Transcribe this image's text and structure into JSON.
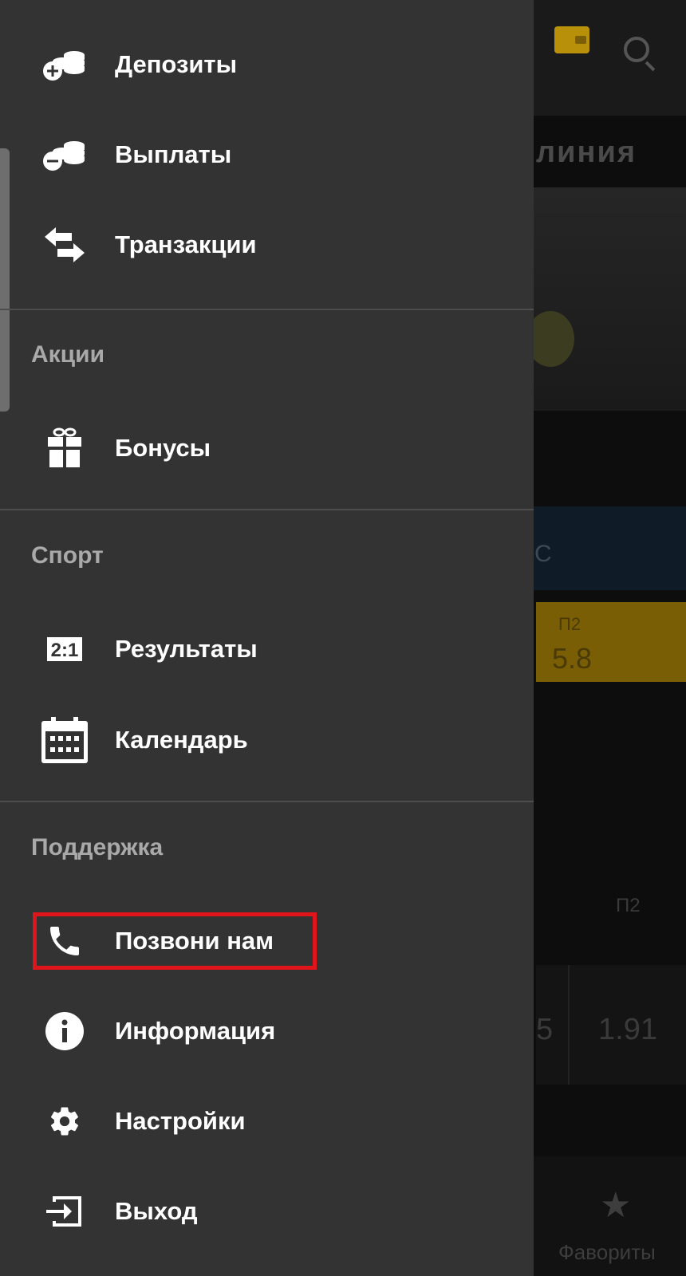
{
  "background": {
    "title_partial": "линия",
    "league_partial": "С",
    "odds_label": "П2",
    "odds_value": "5.8",
    "table_header_p2": "П2",
    "row_value_partial": "5",
    "row_value": "1.91",
    "bottom_nav_favorites": "Фавориты",
    "icons": [
      "wallet-icon",
      "search-icon",
      "star-icon"
    ]
  },
  "drawer": {
    "items_top": [
      {
        "label": "Депозиты",
        "icon": "coins-plus-icon"
      },
      {
        "label": "Выплаты",
        "icon": "coins-minus-icon"
      },
      {
        "label": "Транзакции",
        "icon": "swap-arrows-icon"
      }
    ],
    "sections": [
      {
        "title": "Акции",
        "items": [
          {
            "label": "Бонусы",
            "icon": "gift-icon"
          }
        ]
      },
      {
        "title": "Спорт",
        "items": [
          {
            "label": "Результаты",
            "icon": "score-icon",
            "icon_text": "2:1"
          },
          {
            "label": "Календарь",
            "icon": "calendar-icon"
          }
        ]
      },
      {
        "title": "Поддержка",
        "items": [
          {
            "label": "Позвони нам",
            "icon": "phone-icon",
            "highlighted": true
          },
          {
            "label": "Информация",
            "icon": "info-icon"
          },
          {
            "label": "Настройки",
            "icon": "gear-icon"
          },
          {
            "label": "Выход",
            "icon": "exit-icon"
          }
        ]
      }
    ]
  },
  "colors": {
    "drawer_bg": "#333333",
    "highlight": "#e0141b",
    "accent": "#f5b800"
  }
}
